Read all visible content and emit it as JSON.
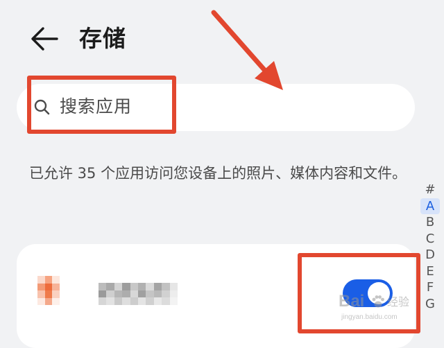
{
  "header": {
    "back_icon": "arrow-left-icon",
    "title": "存储"
  },
  "search": {
    "icon": "search-icon",
    "placeholder": "搜索应用"
  },
  "description": "已允许 35 个应用访问您设备上的照片、媒体内容和文件。",
  "alpha_index": {
    "letters": [
      "#",
      "A",
      "B",
      "C",
      "D",
      "E",
      "F",
      "G"
    ],
    "active": "A"
  },
  "app_list": [
    {
      "name_obscured": true,
      "icon_obscured": true,
      "toggle_on": true
    }
  ],
  "colors": {
    "background": "#f1f2f4",
    "card": "#ffffff",
    "accent": "#1a5ee6",
    "annotation": "#e2472f"
  },
  "watermark": {
    "text": "Bai",
    "side_text": "经验",
    "url": "jingyan.baidu.com"
  }
}
